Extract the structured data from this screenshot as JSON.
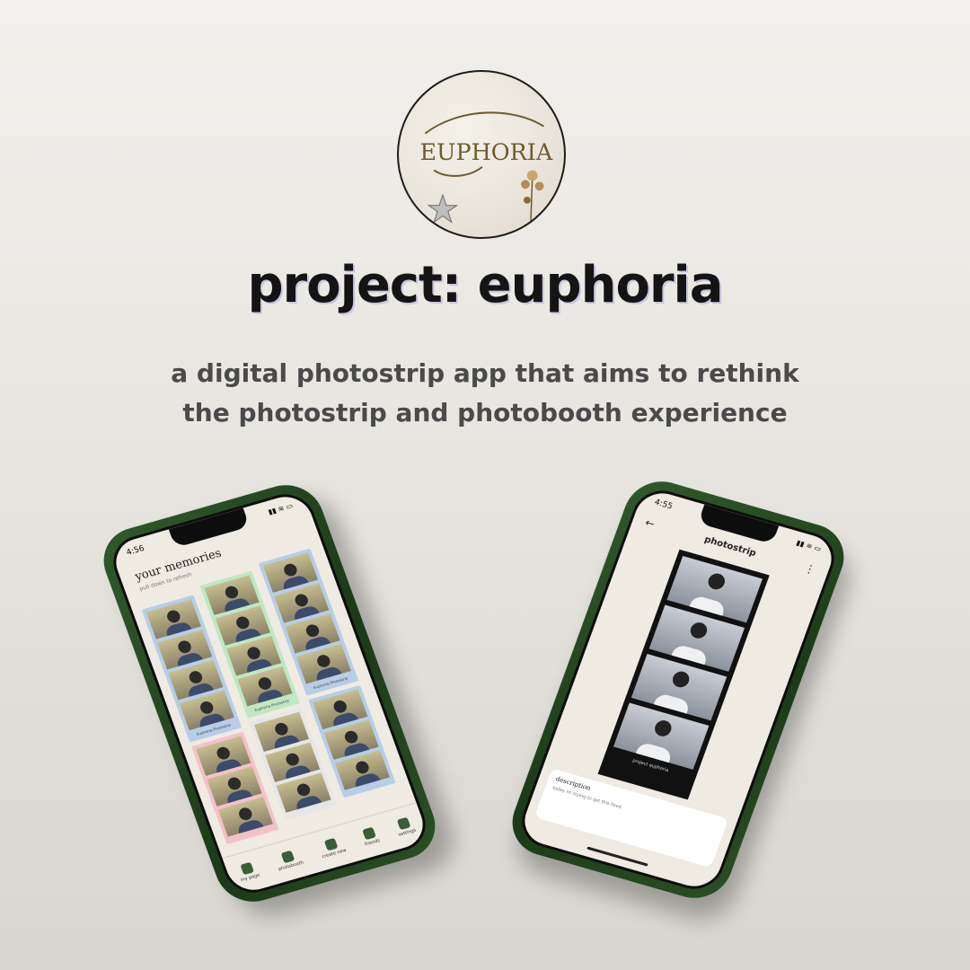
{
  "logo": {
    "wordmark": "EUPHORIA"
  },
  "headline": "project: euphoria",
  "tagline": {
    "line1": "a digital photostrip app that aims to rethink",
    "line2": "the photostrip and photobooth experience"
  },
  "left_phone": {
    "status_time": "4:56",
    "title": "your memories",
    "subtitle": "pull down to refresh",
    "strips": [
      {
        "color": "#b7cde8",
        "label": "Euphoria Photostrip"
      },
      {
        "color": "#bfe7c4",
        "label": "Euphoria Photostrip"
      },
      {
        "color": "#b7cde8",
        "label": "Euphoria Photostrip"
      },
      {
        "color": "#f3c2c8",
        "label": ""
      },
      {
        "color": "#e6e6e6",
        "label": ""
      },
      {
        "color": "#b7cde8",
        "label": ""
      }
    ],
    "tabs": [
      "my page",
      "photobooth",
      "create new",
      "friends",
      "settings"
    ]
  },
  "right_phone": {
    "status_time": "4:55",
    "title": "photostrip",
    "strip_caption": "project euphoria",
    "description_heading": "description",
    "description_text": "today im trying to get this fixed"
  },
  "colors": {
    "phone_body": "#234a20",
    "headline_shadow": "#c9c6df"
  }
}
